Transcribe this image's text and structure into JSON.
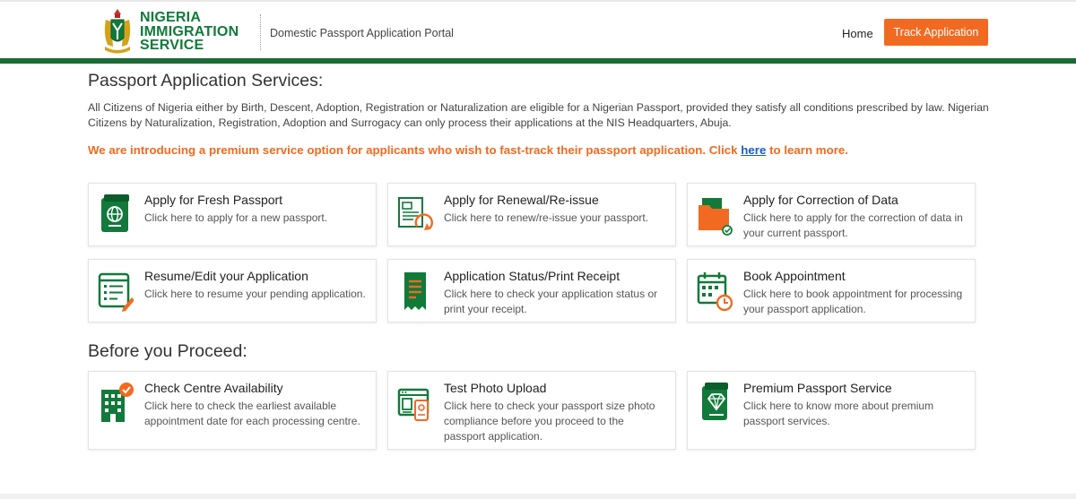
{
  "header": {
    "logo_line1": "NIGERIA",
    "logo_line2": "IMMIGRATION",
    "logo_line3": "SERVICE",
    "portal_title": "Domestic Passport Application Portal",
    "nav_home": "Home",
    "nav_track": "Track Application"
  },
  "services_section": {
    "title": "Passport Application Services:",
    "intro": "All Citizens of Nigeria either by Birth, Descent, Adoption, Registration or Naturalization are eligible for a Nigerian Passport, provided they satisfy all conditions prescribed by law. Nigerian Citizens by Naturalization, Registration, Adoption and Surrogacy can only process their applications at the NIS Headquarters, Abuja.",
    "premium_prefix": "We are introducing a premium service option for applicants who wish to fast-track their passport application. Click ",
    "premium_link": "here",
    "premium_suffix": " to learn more."
  },
  "service_cards": [
    {
      "title": "Apply for Fresh Passport",
      "desc": "Click here to apply for a new passport.",
      "icon": "passport-icon"
    },
    {
      "title": "Apply for Renewal/Re-issue",
      "desc": "Click here to renew/re-issue your passport.",
      "icon": "renewal-icon"
    },
    {
      "title": "Apply for Correction of Data",
      "desc": "Click here to apply for the correction of data in your current passport.",
      "icon": "correction-folder-icon"
    },
    {
      "title": "Resume/Edit your Application",
      "desc": "Click here to resume your pending application.",
      "icon": "edit-form-icon"
    },
    {
      "title": "Application Status/Print Receipt",
      "desc": "Click here to check your application status or print your receipt.",
      "icon": "receipt-icon"
    },
    {
      "title": "Book Appointment",
      "desc": "Click here to book appointment for processing your passport application.",
      "icon": "calendar-clock-icon"
    }
  ],
  "proceed_section": {
    "title": "Before you Proceed:"
  },
  "proceed_cards": [
    {
      "title": "Check Centre Availability",
      "desc": "Click here to check the earliest available appointment date for each processing centre.",
      "icon": "building-check-icon"
    },
    {
      "title": "Test Photo Upload",
      "desc": "Click here to check your passport size photo compliance before you proceed to the passport application.",
      "icon": "photo-upload-icon"
    },
    {
      "title": "Premium Passport Service",
      "desc": "Click here to know more about premium passport services.",
      "icon": "premium-diamond-icon"
    }
  ],
  "colors": {
    "brand_green": "#1a6b36",
    "accent_orange": "#f26a21",
    "link_blue": "#1a5dc8"
  }
}
